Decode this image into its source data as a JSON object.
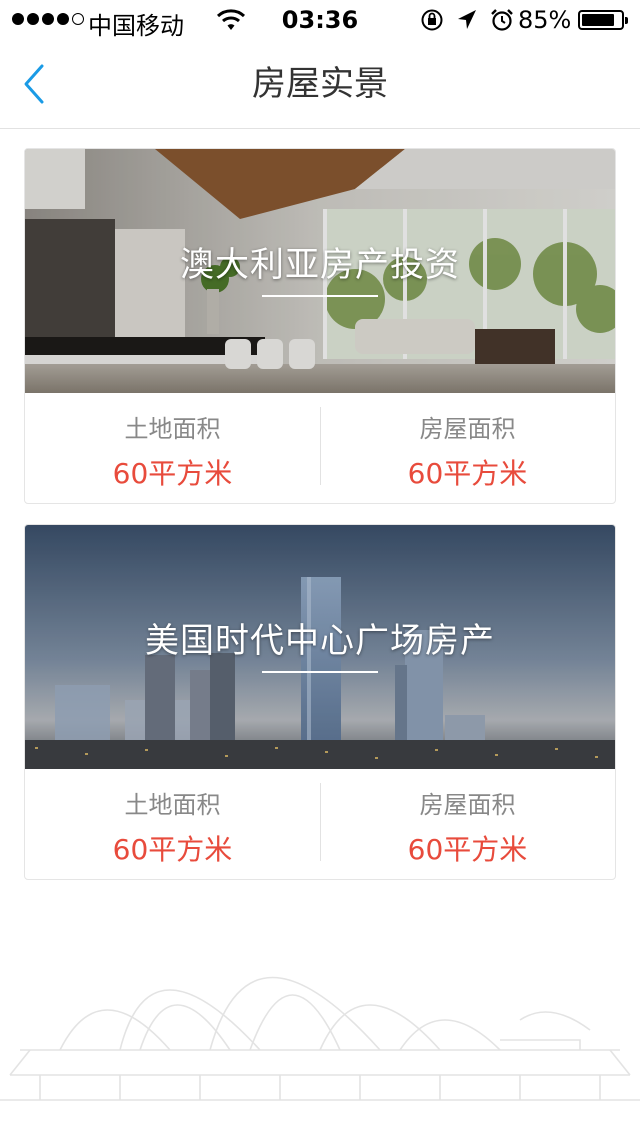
{
  "status_bar": {
    "carrier": "中国移动",
    "time": "03:36",
    "battery_percent": "85%",
    "battery_level": 0.85,
    "signal_bars_filled": 4,
    "signal_bars_total": 5,
    "icons": [
      "wifi-icon",
      "orientation-lock-icon",
      "location-arrow-icon",
      "alarm-icon",
      "battery-icon"
    ]
  },
  "nav": {
    "title": "房屋实景",
    "back_icon": "chevron-left-icon",
    "accent_color": "#1a9be6"
  },
  "properties": [
    {
      "title": "澳大利亚房产投资",
      "stats": [
        {
          "label": "土地面积",
          "value": "60平方米"
        },
        {
          "label": "房屋面积",
          "value": "60平方米"
        }
      ]
    },
    {
      "title": "美国时代中心广场房产",
      "stats": [
        {
          "label": "土地面积",
          "value": "60平方米"
        },
        {
          "label": "房屋面积",
          "value": "60平方米"
        }
      ]
    }
  ],
  "colors": {
    "value_red": "#e84b3c",
    "label_gray": "#888888"
  }
}
